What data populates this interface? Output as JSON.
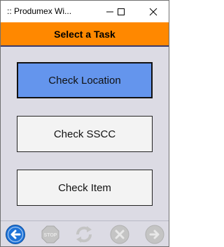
{
  "window": {
    "title": ":: Produmex Wi..."
  },
  "header": {
    "title": "Select a Task"
  },
  "tasks": [
    {
      "label": "Check Location",
      "selected": true
    },
    {
      "label": "Check SSCC",
      "selected": false
    },
    {
      "label": "Check Item",
      "selected": false
    }
  ],
  "toolbar": {
    "stop_label": "STOP",
    "buttons": [
      {
        "icon": "back-arrow-icon",
        "enabled": true,
        "color": "#1e73d8"
      },
      {
        "icon": "stop-icon",
        "enabled": false
      },
      {
        "icon": "refresh-icon",
        "enabled": false
      },
      {
        "icon": "cancel-icon",
        "enabled": false
      },
      {
        "icon": "forward-arrow-icon",
        "enabled": false
      }
    ]
  },
  "colors": {
    "header_bg": "#ff8800",
    "selected_bg": "#6495ed",
    "body_bg": "#dcdbe4"
  }
}
